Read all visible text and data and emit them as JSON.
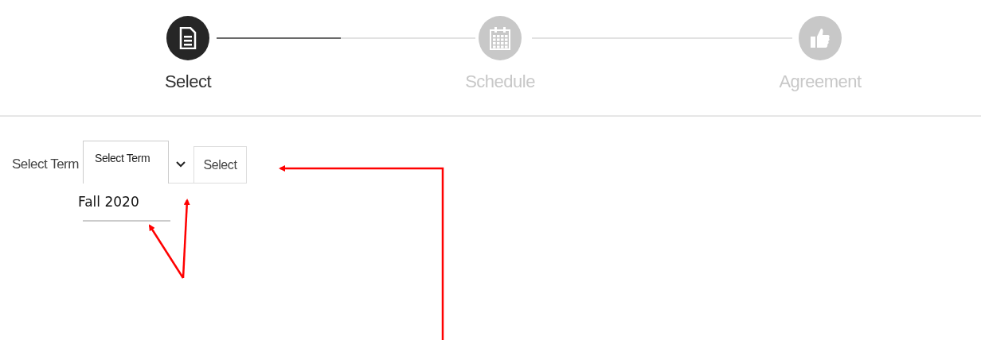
{
  "steps": [
    {
      "label": "Select",
      "kind": "document",
      "selected": true
    },
    {
      "label": "Schedule",
      "kind": "calendar",
      "selected": false
    },
    {
      "label": "Agreement",
      "kind": "thumbs-up",
      "selected": false
    }
  ],
  "progress": {
    "level": 0.48
  },
  "term_form": {
    "label": "Select Term",
    "select_value": "Select Term",
    "button": "Select",
    "dropdown_open": true,
    "options": [
      "Fall 2020"
    ]
  }
}
